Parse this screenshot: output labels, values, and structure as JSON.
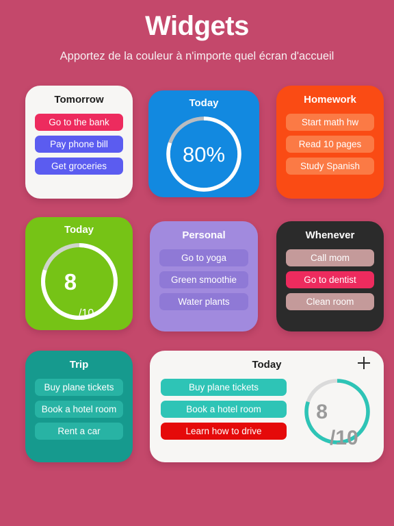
{
  "header": {
    "title": "Widgets",
    "subtitle": "Apportez de la couleur à n'importe quel écran d'accueil"
  },
  "colors": {
    "background": "#c4486b",
    "white_card": "#f7f6f4",
    "pink": "#ed2b5e",
    "blue_purple": "#5b5cf0",
    "blue": "#1289e0",
    "orange": "#fa4b14",
    "orange_row": "#fb7a45",
    "green": "#76c316",
    "purple": "#a18ade",
    "purple_row": "#8f79d6",
    "dark": "#2b2b2b",
    "rose_row": "#c49a9a",
    "teal": "#169a8e",
    "teal_row": "#28b3a4",
    "teal_ring": "#2ec4b6",
    "red": "#e50a0a",
    "gray_track": "#d8d8d8",
    "gray_text": "#9a9a9a"
  },
  "widgets": {
    "tomorrow": {
      "title": "Tomorrow",
      "items": [
        {
          "label": "Go to the bank",
          "color": "#ed2b5e"
        },
        {
          "label": "Pay phone bill",
          "color": "#5b5cf0"
        },
        {
          "label": "Get groceries",
          "color": "#5b5cf0"
        }
      ]
    },
    "today_blue": {
      "title": "Today",
      "progress_percent": 80,
      "value_label": "80%"
    },
    "homework": {
      "title": "Homework",
      "items": [
        {
          "label": "Start math hw"
        },
        {
          "label": "Read 10 pages"
        },
        {
          "label": "Study Spanish"
        }
      ]
    },
    "today_green": {
      "title": "Today",
      "progress_percent": 80,
      "value": "8",
      "value_suffix": "/10"
    },
    "personal": {
      "title": "Personal",
      "items": [
        {
          "label": "Go to yoga"
        },
        {
          "label": "Green smoothie"
        },
        {
          "label": "Water plants"
        }
      ]
    },
    "whenever": {
      "title": "Whenever",
      "items": [
        {
          "label": "Call mom",
          "color": "#c49a9a"
        },
        {
          "label": "Go to dentist",
          "color": "#ed2b5e"
        },
        {
          "label": "Clean room",
          "color": "#c49a9a"
        }
      ]
    },
    "trip": {
      "title": "Trip",
      "items": [
        {
          "label": "Buy plane tickets"
        },
        {
          "label": "Book a hotel room"
        },
        {
          "label": "Rent a car"
        }
      ]
    },
    "today_wide": {
      "title": "Today",
      "add_icon": "plus-icon",
      "items": [
        {
          "label": "Buy plane tickets",
          "color": "#2ec4b6"
        },
        {
          "label": "Book a hotel room",
          "color": "#2ec4b6"
        },
        {
          "label": "Learn how to drive",
          "color": "#e50a0a"
        }
      ],
      "progress_percent": 80,
      "value": "8",
      "value_suffix": "/10"
    }
  }
}
